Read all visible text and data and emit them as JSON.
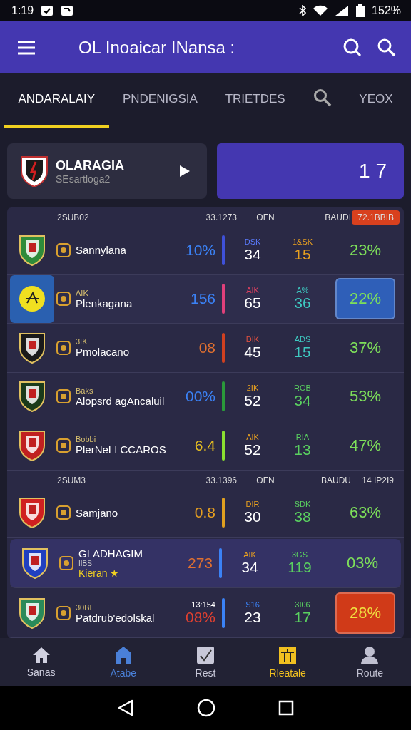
{
  "status_bar": {
    "time": "1:19",
    "battery": "152%"
  },
  "app_bar": {
    "title": "OL Inoaicar INansa :"
  },
  "tabs": [
    {
      "label": "ANDARALAIY",
      "selected": true,
      "kind": "text"
    },
    {
      "label": "PNDENIGSIA",
      "selected": false,
      "kind": "text"
    },
    {
      "label": "TRIETDES",
      "selected": false,
      "kind": "text"
    },
    {
      "selected": false,
      "kind": "search"
    },
    {
      "label": "YEOX",
      "selected": false,
      "kind": "text"
    }
  ],
  "featured": {
    "title": "OLARAGIA",
    "subtitle": "SEsartloga2",
    "score": "1 7"
  },
  "sections": [
    {
      "header": {
        "column_1": "2SUB02",
        "column_2": "33.1273",
        "column_3": "OFN",
        "column_4": "BAUDI",
        "column_5": {
          "text": "72.1BBIB",
          "badge": {
            "color": "#d8401e"
          }
        }
      },
      "rows": [
        {
          "name": "Sannylana",
          "crest": {
            "color": "#2e8b3a"
          },
          "value_1": {
            "text": "10%",
            "color": "#3b82f6"
          },
          "bar": {
            "color": "#3f51d8"
          },
          "small_2": {
            "text": "DSK",
            "color": "#5b7cff"
          },
          "value_2": "34",
          "small_3": {
            "text": "1&SK",
            "color": "#e8a020"
          },
          "value_3": {
            "text": "15",
            "color": "#e8a020"
          },
          "percent": {
            "text": "23%",
            "color": "#7ee05a"
          },
          "selected": false,
          "emphasized": false
        },
        {
          "tag": "AIK",
          "name": "Plenkagana",
          "crest": {
            "color": "#f0e020"
          },
          "value_1": {
            "text": "156",
            "color": "#3b82f6"
          },
          "bar": {
            "color": "#e0407a"
          },
          "small_2": {
            "text": "AIK",
            "color": "#e04060"
          },
          "value_2": "65",
          "small_3": {
            "text": "A%",
            "color": "#3ec8c0"
          },
          "value_3": {
            "text": "36",
            "color": "#3ec8c0"
          },
          "percent": {
            "text": "22%",
            "color": "#7ee05a",
            "badge": {
              "color": "#2f5fb8"
            }
          },
          "selected": true,
          "emphasized": false
        },
        {
          "tag": "3IK",
          "name": "Pmolacano",
          "crest": {
            "color": "#1a1a1a"
          },
          "value_1": {
            "text": "08",
            "color": "#e07030"
          },
          "bar": {
            "color": "#d04020"
          },
          "small_2": {
            "text": "DIK",
            "color": "#e05040"
          },
          "value_2": "45",
          "small_3": {
            "text": "ADS",
            "color": "#3ec8c0"
          },
          "value_3": {
            "text": "15",
            "color": "#3ec8c0"
          },
          "percent": {
            "text": "37%",
            "color": "#7ee05a"
          },
          "selected": false,
          "emphasized": false
        },
        {
          "tag": "Baks",
          "name": "Alopsrd agAncaluil",
          "crest": {
            "color": "#1a3a1a"
          },
          "value_1": {
            "text": "00%",
            "color": "#3b82f6"
          },
          "bar": {
            "color": "#2a9a3a"
          },
          "small_2": {
            "text": "2IK",
            "color": "#e8a020"
          },
          "value_2": "52",
          "small_3": {
            "text": "ROB",
            "color": "#5ad060"
          },
          "value_3": {
            "text": "34",
            "color": "#5ad060"
          },
          "percent": {
            "text": "53%",
            "color": "#7ee05a"
          },
          "selected": false,
          "emphasized": false
        },
        {
          "tag": "Bobbi",
          "name": "PlerNeLI CCAROS",
          "crest": {
            "color": "#c02020"
          },
          "value_1": {
            "text": "6.4",
            "color": "#e8c020"
          },
          "bar": {
            "color": "#8ae030"
          },
          "small_2": {
            "text": "AIK",
            "color": "#e8a020"
          },
          "value_2": "52",
          "small_3": {
            "text": "RIA",
            "color": "#5ad060"
          },
          "value_3": {
            "text": "13",
            "color": "#5ad060"
          },
          "percent": {
            "text": "47%",
            "color": "#7ee05a"
          },
          "selected": false,
          "emphasized": false
        }
      ]
    },
    {
      "header": {
        "column_1": "2SUM3",
        "column_2": "33.1396",
        "column_3": "OFN",
        "column_4": "BAUDU",
        "column_5": {
          "text": "14 IP2I9"
        }
      },
      "rows": [
        {
          "name": "Samjano",
          "crest": {
            "color": "#d02020"
          },
          "value_1": {
            "text": "0.8",
            "color": "#e8a020"
          },
          "bar": {
            "color": "#e0a020"
          },
          "small_2": {
            "text": "DIR",
            "color": "#e8a020"
          },
          "value_2": "30",
          "small_3": {
            "text": "SDK",
            "color": "#5ad060"
          },
          "value_3": {
            "text": "38",
            "color": "#5ad060"
          },
          "percent": {
            "text": "63%",
            "color": "#7ee05a"
          },
          "selected": false,
          "emphasized": false
        },
        {
          "name": "GLADHAGIM",
          "note": "IIBS",
          "subtitle": "Kieran ★",
          "crest": {
            "color": "#2040c0"
          },
          "value_1": {
            "text": "273",
            "color": "#e07030"
          },
          "bar": {
            "color": "#3b82f6"
          },
          "small_2": {
            "text": "AIK",
            "color": "#e8a020"
          },
          "value_2": "34",
          "small_3": {
            "text": "3GS",
            "color": "#5ad060"
          },
          "value_3": {
            "text": "119",
            "color": "#5ad060"
          },
          "percent": {
            "text": "03%",
            "color": "#7ee05a"
          },
          "selected": false,
          "emphasized": true
        },
        {
          "tag": "30BI",
          "name": "Patdrub'edolskal",
          "crest": {
            "color": "#2a8a5a"
          },
          "small_1": "13:154",
          "value_1": {
            "text": "08%",
            "color": "#e04030"
          },
          "bar": {
            "color": "#3b82f6"
          },
          "small_2": {
            "text": "S16",
            "color": "#3b82f6"
          },
          "value_2": "23",
          "small_3": {
            "text": "3I06",
            "color": "#5ad060"
          },
          "value_3": {
            "text": "17",
            "color": "#5ad060"
          },
          "percent": {
            "text": "28%",
            "color": "#f0e040",
            "badge": {
              "color": "#d03a18"
            }
          },
          "selected": false,
          "emphasized": false
        }
      ]
    }
  ],
  "bottom_nav": [
    {
      "label": "Sanas",
      "kind": "home",
      "color": "#d0d0e0"
    },
    {
      "label": "Atabe",
      "kind": "house",
      "color": "#4a80d8"
    },
    {
      "label": "Rest",
      "kind": "check",
      "color": "#c8c8d8"
    },
    {
      "label": "Rleatale",
      "kind": "board",
      "color": "#f0c020"
    },
    {
      "label": "Route",
      "kind": "person",
      "color": "#c0c0d0"
    }
  ]
}
